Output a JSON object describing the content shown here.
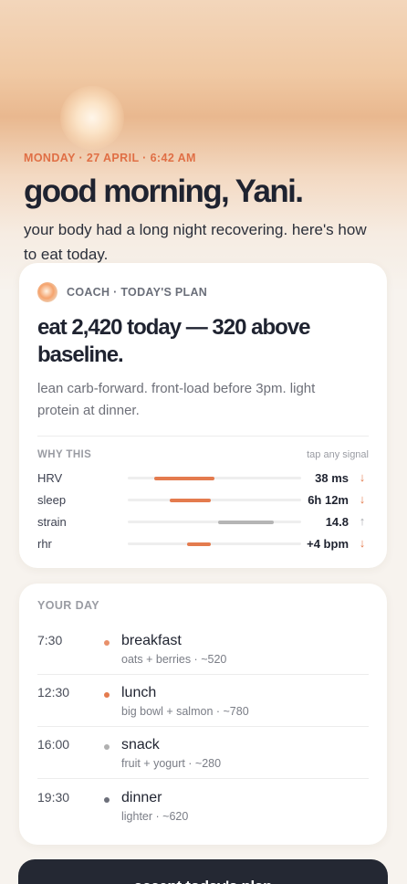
{
  "header": {
    "date": "MONDAY · 27 APRIL · 6:42 AM",
    "greeting": "good morning, Yani.",
    "intro": "your body had a long night recovering. here's how to eat today."
  },
  "plan": {
    "coach_label": "COACH · TODAY'S PLAN",
    "headline": "eat 2,420 today — 320 above baseline.",
    "description": "lean carb-forward. front-load before 3pm. light protein at dinner.",
    "why_label": "WHY THIS",
    "why_hint": "tap any signal",
    "signals": [
      {
        "name": "HRV",
        "value": "38 ms",
        "arrow": "↓",
        "color": "#e47b4e",
        "arrow_color": "#e47b4e",
        "range": [
          0.15,
          0.5
        ]
      },
      {
        "name": "sleep",
        "value": "6h 12m",
        "arrow": "↓",
        "color": "#e47b4e",
        "arrow_color": "#e47b4e",
        "range": [
          0.24,
          0.48
        ]
      },
      {
        "name": "strain",
        "value": "14.8",
        "arrow": "↑",
        "color": "#b5b5b5",
        "arrow_color": "#a8aab0",
        "range": [
          0.52,
          0.84
        ]
      },
      {
        "name": "rhr",
        "value": "+4 bpm",
        "arrow": "↓",
        "color": "#e47b4e",
        "arrow_color": "#e47b4e",
        "range": [
          0.34,
          0.48
        ]
      }
    ]
  },
  "day": {
    "title": "YOUR DAY",
    "meals": [
      {
        "time": "7:30",
        "name": "breakfast",
        "detail": "oats + berries · ~520",
        "dot_color": "#e8906a"
      },
      {
        "time": "12:30",
        "name": "lunch",
        "detail": "big bowl + salmon · ~780",
        "dot_color": "#e47b4e"
      },
      {
        "time": "16:00",
        "name": "snack",
        "detail": "fruit + yogurt · ~280",
        "dot_color": "#b0b0b0"
      },
      {
        "time": "19:30",
        "name": "dinner",
        "detail": "lighter · ~620",
        "dot_color": "#6c6f7a"
      }
    ]
  },
  "cta": {
    "label": "accept today's plan"
  }
}
